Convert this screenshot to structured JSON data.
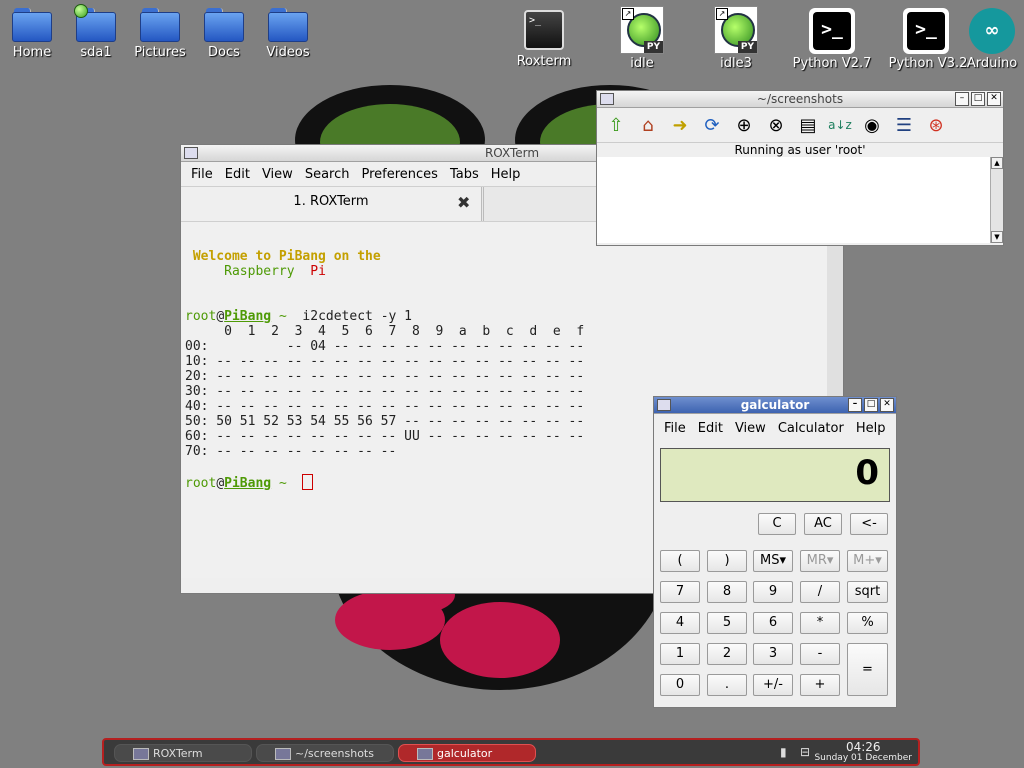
{
  "desktop": {
    "icons": [
      {
        "label": "Home"
      },
      {
        "label": "sda1"
      },
      {
        "label": "Pictures"
      },
      {
        "label": "Docs"
      },
      {
        "label": "Videos"
      }
    ],
    "apps": [
      {
        "label": "Roxterm",
        "glyph": ">_"
      },
      {
        "label": "idle",
        "badge": "PY"
      },
      {
        "label": "idle3",
        "badge": "PY"
      },
      {
        "label": "Python V2.7",
        "glyph": ">_"
      },
      {
        "label": "Python V3.2",
        "glyph": ">_"
      },
      {
        "label": "Arduino",
        "glyph": "∞"
      }
    ]
  },
  "terminal": {
    "title": "ROXTerm",
    "menu": [
      "File",
      "Edit",
      "View",
      "Search",
      "Preferences",
      "Tabs",
      "Help"
    ],
    "tab": "1. ROXTerm",
    "welcome1": "Welcome to PiBang on the",
    "welcome2a": "Raspberry",
    "welcome2b": "Pi",
    "prompt_user": "root",
    "prompt_at": "@",
    "prompt_host": "PiBang",
    "prompt_tilde": "~",
    "command": "i2cdetect -y 1",
    "output": [
      "     0  1  2  3  4  5  6  7  8  9  a  b  c  d  e  f",
      "00:          -- 04 -- -- -- -- -- -- -- -- -- -- --",
      "10: -- -- -- -- -- -- -- -- -- -- -- -- -- -- -- --",
      "20: -- -- -- -- -- -- -- -- -- -- -- -- -- -- -- --",
      "30: -- -- -- -- -- -- -- -- -- -- -- -- -- -- -- --",
      "40: -- -- -- -- -- -- -- -- -- -- -- -- -- -- -- --",
      "50: 50 51 52 53 54 55 56 57 -- -- -- -- -- -- -- --",
      "60: -- -- -- -- -- -- -- -- UU -- -- -- -- -- -- --",
      "70: -- -- -- -- -- -- -- --"
    ]
  },
  "filemanager": {
    "title": "~/screenshots",
    "status": "Running as user 'root'",
    "toolbar": [
      "up-icon",
      "home-icon",
      "bookmarks-icon",
      "refresh-icon",
      "zoom-in-icon",
      "zoom-fit-icon",
      "details-icon",
      "sort-icon",
      "show-hidden-icon",
      "list-icon",
      "help-icon"
    ]
  },
  "calculator": {
    "title": "galculator",
    "menu": [
      "File",
      "Edit",
      "View",
      "Calculator",
      "Help"
    ],
    "display": "0",
    "buttons": {
      "c": "C",
      "ac": "AC",
      "back": "<-",
      "lparen": "(",
      "rparen": ")",
      "ms": "MS",
      "mr": "MR",
      "mplus": "M+",
      "d7": "7",
      "d8": "8",
      "d9": "9",
      "div": "/",
      "sqrt": "sqrt",
      "d4": "4",
      "d5": "5",
      "d6": "6",
      "mul": "*",
      "pct": "%",
      "d1": "1",
      "d2": "2",
      "d3": "3",
      "sub": "-",
      "eq": "=",
      "d0": "0",
      "dot": ".",
      "sign": "+/-",
      "add": "+"
    }
  },
  "taskbar": {
    "tasks": [
      "ROXTerm",
      "~/screenshots",
      "galculator"
    ],
    "time": "04:26",
    "date": "Sunday 01 December"
  }
}
